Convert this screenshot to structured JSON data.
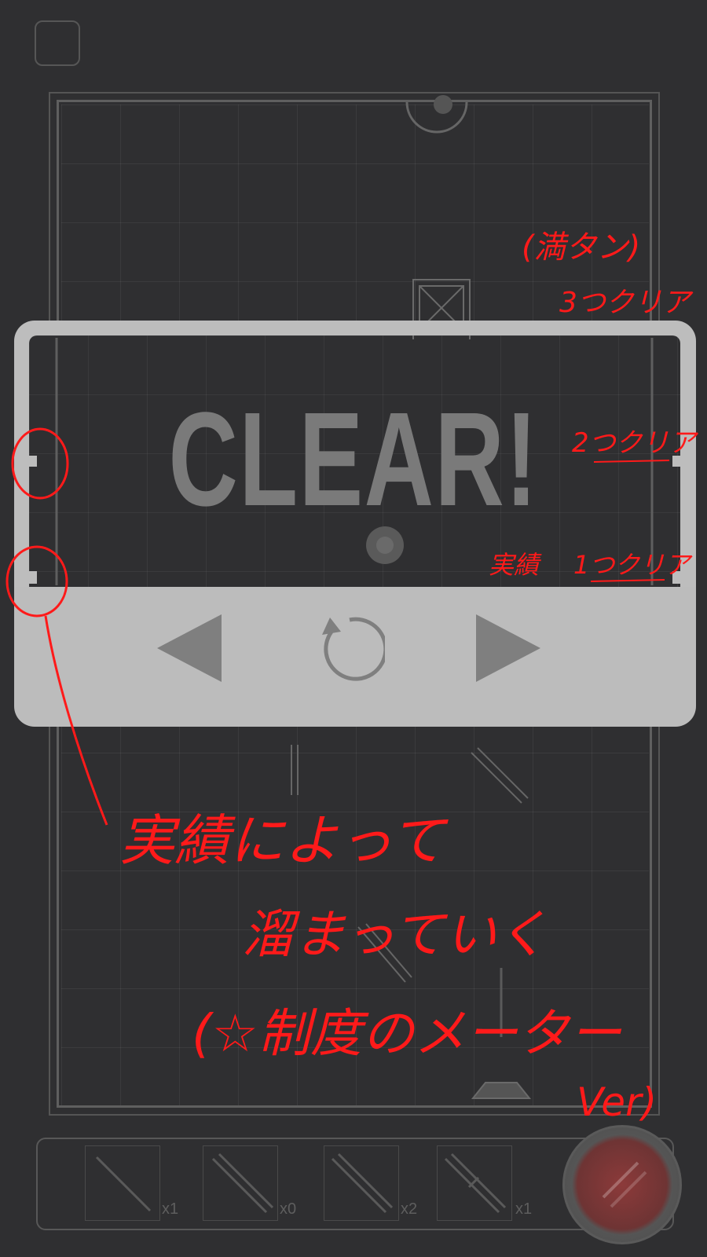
{
  "hud": {
    "menu_icon": "square-menu-icon"
  },
  "clear_panel": {
    "title": "CLEAR!",
    "controls": [
      {
        "name": "prev-button",
        "icon": "triangle-left-icon"
      },
      {
        "name": "retry-button",
        "icon": "retry-arrow-icon"
      },
      {
        "name": "next-button",
        "icon": "triangle-right-icon"
      }
    ]
  },
  "inventory": {
    "slots": [
      {
        "item": "single-mirror-icon",
        "count": "x1"
      },
      {
        "item": "double-mirror-icon",
        "count": "x0"
      },
      {
        "item": "double-mirror-icon",
        "count": "x2"
      },
      {
        "item": "split-mirror-icon",
        "count": "x1"
      }
    ],
    "fire_button_icon": "fire-button-icon"
  },
  "annotations": {
    "full_tank": "(満タン)",
    "clear_3": "3つクリア",
    "clear_2": "2つクリア",
    "achievement_label": "実績",
    "clear_1": "1つクリア",
    "note_line1": "実績によって",
    "note_line2": "溜まっていく",
    "note_line3": "(☆制度のメーター",
    "note_line4": "Ver)"
  },
  "colors": {
    "background": "#2f2f31",
    "panel": "#bdbdbd",
    "clear_text": "#7a7a7a",
    "annotation": "#ff1a1a"
  }
}
